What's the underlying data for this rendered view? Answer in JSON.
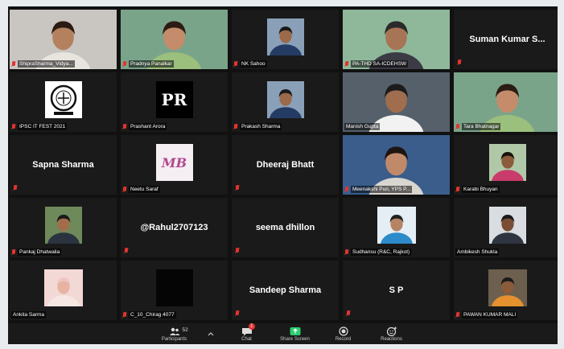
{
  "participants": [
    {
      "name": "ShipraSharma_Vidya...",
      "mic_muted": true,
      "kind": "video",
      "palette": "girl"
    },
    {
      "name": "Pradnya Panalkar",
      "mic_muted": true,
      "kind": "video",
      "palette": "woman-green"
    },
    {
      "name": "NK Sahoo",
      "mic_muted": true,
      "kind": "photo",
      "palette": "man-suit"
    },
    {
      "name": "PA-THD SA-ICDEHSW",
      "mic_muted": true,
      "kind": "video",
      "palette": "man-green"
    },
    {
      "name": "Suman Kumar S...",
      "mic_muted": true,
      "kind": "name"
    },
    {
      "name": "IPSC IT FEST 2021",
      "mic_muted": true,
      "kind": "logo-seal"
    },
    {
      "name": "Prashant Arora",
      "mic_muted": true,
      "kind": "logo-pr"
    },
    {
      "name": "Prakash Sharma",
      "mic_muted": true,
      "kind": "photo",
      "palette": "man-suit"
    },
    {
      "name": "Manish Gupta",
      "mic_muted": false,
      "kind": "video",
      "palette": "man-headset",
      "active": true
    },
    {
      "name": "Tara Bhatnagar",
      "mic_muted": true,
      "kind": "video",
      "palette": "woman-green"
    },
    {
      "name": "Sapna Sharma",
      "mic_muted": true,
      "kind": "name"
    },
    {
      "name": "Neetu Saraf",
      "mic_muted": true,
      "kind": "logo-ns"
    },
    {
      "name": "Dheeraj Bhatt",
      "mic_muted": true,
      "kind": "name"
    },
    {
      "name": "Meenakshi Puri, YPS P...",
      "mic_muted": true,
      "kind": "video",
      "palette": "woman-blue"
    },
    {
      "name": "Karabi Bhuyan",
      "mic_muted": true,
      "kind": "photo",
      "palette": "woman-outdoor"
    },
    {
      "name": "Pankaj Dhatwalia",
      "mic_muted": true,
      "kind": "photo",
      "palette": "man-outdoor"
    },
    {
      "name": "@Rahul2707123",
      "mic_muted": true,
      "kind": "name"
    },
    {
      "name": "seema dhillon",
      "mic_muted": true,
      "kind": "name"
    },
    {
      "name": "Sudhansu (R&C, Rajkot)",
      "mic_muted": true,
      "kind": "photo",
      "palette": "family"
    },
    {
      "name": "Ambikesh Shukla",
      "mic_muted": false,
      "kind": "photo",
      "palette": "man-road"
    },
    {
      "name": "Ankita Sarma",
      "mic_muted": false,
      "kind": "photo",
      "palette": "baby"
    },
    {
      "name": "C_10_Chirag 4077",
      "mic_muted": true,
      "kind": "dark"
    },
    {
      "name": "Sandeep Sharma",
      "mic_muted": true,
      "kind": "name"
    },
    {
      "name": "S P",
      "mic_muted": true,
      "kind": "name"
    },
    {
      "name": "PAWAN KUMAR MALI",
      "mic_muted": true,
      "kind": "photo",
      "palette": "man-phone"
    }
  ],
  "logos": {
    "pr_text": "PR",
    "ns_text": "MB"
  },
  "toolbar": {
    "participants_count": "52",
    "items": [
      {
        "label": "Participants",
        "icon": "participants-icon"
      },
      {
        "label": "Chat",
        "icon": "chat-icon",
        "badge": "1"
      },
      {
        "label": "Share Screen",
        "icon": "share-screen-icon"
      },
      {
        "label": "Record",
        "icon": "record-icon"
      },
      {
        "label": "Reactions",
        "icon": "reactions-icon"
      }
    ]
  },
  "colors": {
    "mic_muted": "#e3342f",
    "active_speaker": "#d8e83a",
    "tile_bg": "#1a1a1a",
    "share_green": "#2ecc71"
  }
}
